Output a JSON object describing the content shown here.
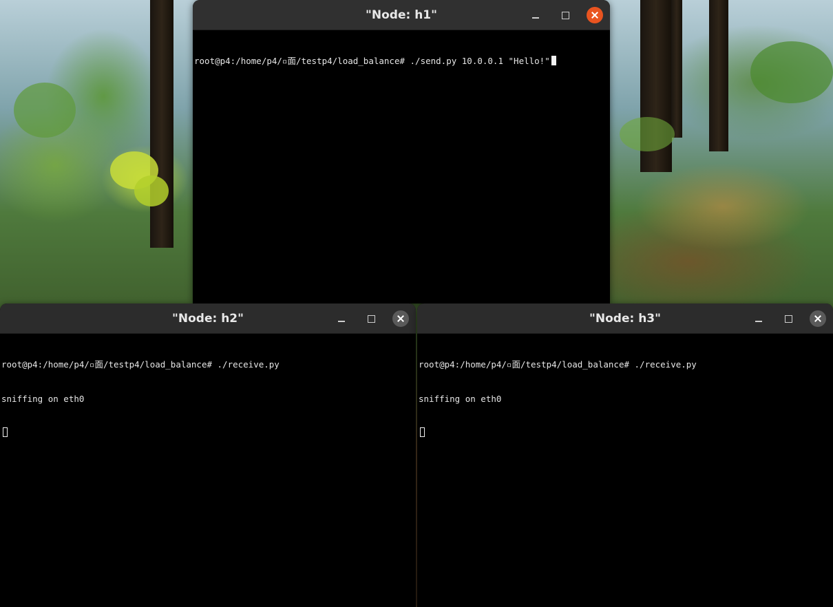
{
  "windows": {
    "h1": {
      "title": "\"Node: h1\"",
      "lines": [
        "root@p4:/home/p4/▫面/testp4/load_balance# ./send.py 10.0.0.1 \"Hello!\""
      ]
    },
    "h2": {
      "title": "\"Node: h2\"",
      "lines": [
        "root@p4:/home/p4/▫面/testp4/load_balance# ./receive.py",
        "sniffing on eth0"
      ]
    },
    "h3": {
      "title": "\"Node: h3\"",
      "lines": [
        "root@p4:/home/p4/▫面/testp4/load_balance# ./receive.py",
        "sniffing on eth0"
      ]
    }
  },
  "icons": {
    "minimize": "minimize-icon",
    "maximize": "maximize-icon",
    "close": "close-icon"
  },
  "colors": {
    "terminal_bg": "#000000",
    "titlebar_bg": "#2c2c2c",
    "active_close": "#e95420",
    "inactive_close": "#5a5a5a"
  }
}
